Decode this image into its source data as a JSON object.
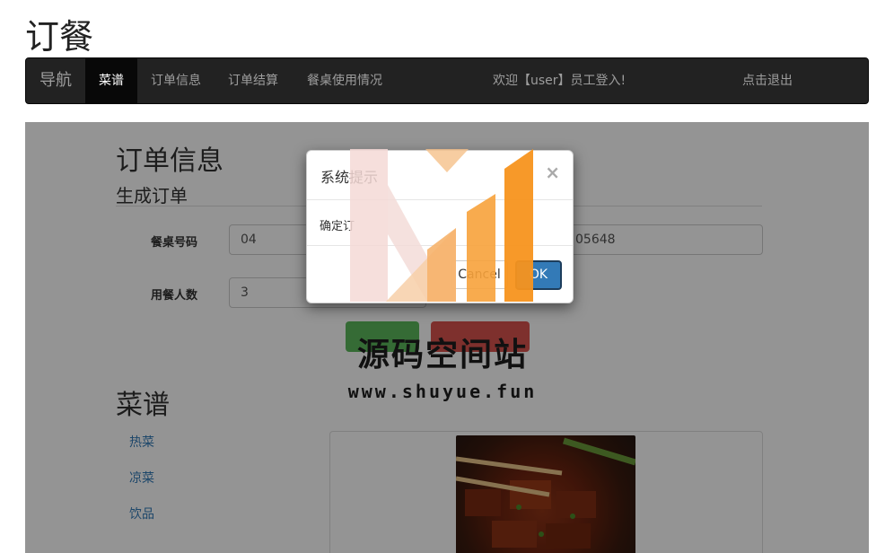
{
  "app": {
    "title": "订餐"
  },
  "navbar": {
    "brand": "导航",
    "items": [
      {
        "label": "菜谱",
        "active": true
      },
      {
        "label": "订单信息",
        "active": false
      },
      {
        "label": "订单结算",
        "active": false
      },
      {
        "label": "餐桌使用情况",
        "active": false
      }
    ],
    "welcome": "欢迎【user】员工登入!",
    "logout": "点击退出"
  },
  "order": {
    "title": "订单信息",
    "subtitle": "生成订单",
    "table_label": "餐桌号码",
    "table_value": "04",
    "order_no_partial": "05648",
    "people_label": "用餐人数",
    "people_value": "3"
  },
  "menu": {
    "title": "菜谱",
    "categories": [
      "热菜",
      "凉菜",
      "饮品"
    ]
  },
  "modal": {
    "title": "系统提示",
    "body": "确定订",
    "cancel": "Cancel",
    "ok": "OK",
    "close": "×"
  },
  "watermark": {
    "text": "源码空间站",
    "url": "www.shuyue.fun"
  },
  "colors": {
    "navbar_bg": "#222222",
    "accent_blue": "#337ab7",
    "success": "#5cb85c",
    "danger": "#d9534f",
    "watermark_orange": "#f7941d"
  }
}
